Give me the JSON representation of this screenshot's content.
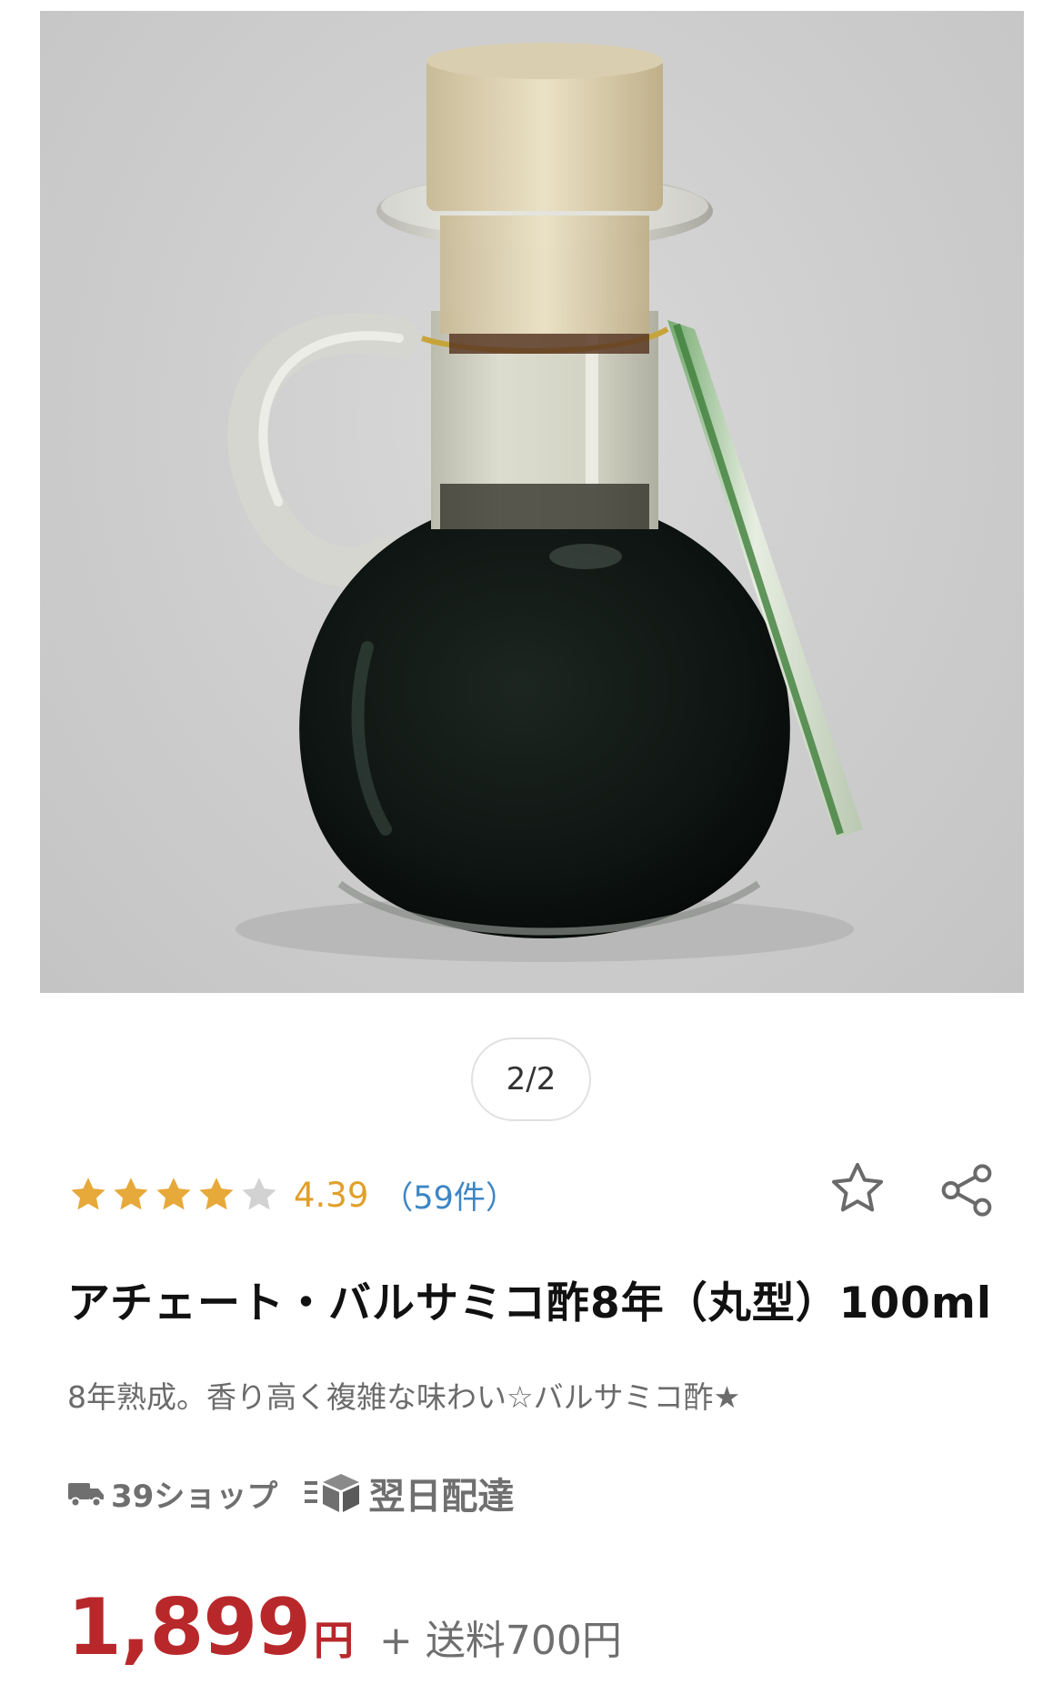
{
  "pager": {
    "current": "2/2"
  },
  "rating": {
    "value": 4.39,
    "score_label": "4.39",
    "count_label": "（59件）",
    "stars_filled": 4,
    "stars_total": 5,
    "star_color": "#e6a93a",
    "star_empty_color": "#d2d2d2"
  },
  "actions": {
    "favorite_icon": "star-outline-icon",
    "share_icon": "share-icon"
  },
  "product": {
    "title": "アチェート・バルサミコ酢8年（丸型）100ml",
    "catch_copy": "8年熟成。香り高く複雑な味わい☆バルサミコ酢★"
  },
  "badges": {
    "shop_label": "39ショップ",
    "shop_icon": "truck-icon",
    "delivery_label": "翌日配達",
    "delivery_icon": "box-icon"
  },
  "price": {
    "amount": "1,899",
    "unit": "円",
    "shipping": "+ 送料700円",
    "color": "#b8282b"
  }
}
